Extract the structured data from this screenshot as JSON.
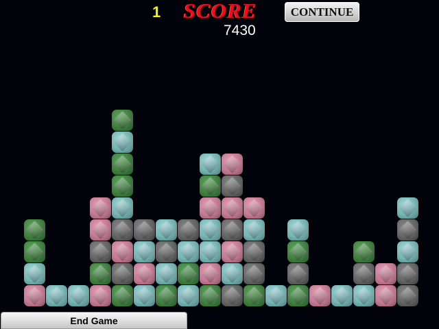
{
  "hud": {
    "level": "1",
    "score_title": "SCORE",
    "score_value": "7430",
    "continue_label": "CONTINUE"
  },
  "footer": {
    "end_game_label": "End Game"
  },
  "colors": {
    "P": "pink",
    "T": "teal",
    "G": "green",
    "D": "gray"
  },
  "board": {
    "columns": [
      [
        "P",
        "T",
        "G",
        "G"
      ],
      [
        "T"
      ],
      [
        "T"
      ],
      [
        "P",
        "G",
        "D",
        "P",
        "P"
      ],
      [
        "G",
        "D",
        "P",
        "D",
        "T",
        "G",
        "G",
        "T",
        "G"
      ],
      [
        "T",
        "P",
        "T",
        "D"
      ],
      [
        "G",
        "T",
        "D",
        "T"
      ],
      [
        "T",
        "G",
        "T",
        "D"
      ],
      [
        "G",
        "P",
        "T",
        "T",
        "P",
        "G",
        "T"
      ],
      [
        "D",
        "T",
        "P",
        "D",
        "P",
        "D",
        "P"
      ],
      [
        "G",
        "D",
        "D",
        "T",
        "P"
      ],
      [
        "T"
      ],
      [
        "G",
        "D",
        "G",
        "T"
      ],
      [
        "P"
      ],
      [
        "T"
      ],
      [
        "T",
        "D",
        "G"
      ],
      [
        "P",
        "P"
      ],
      [
        "D",
        "D",
        "T",
        "D",
        "T"
      ]
    ]
  }
}
